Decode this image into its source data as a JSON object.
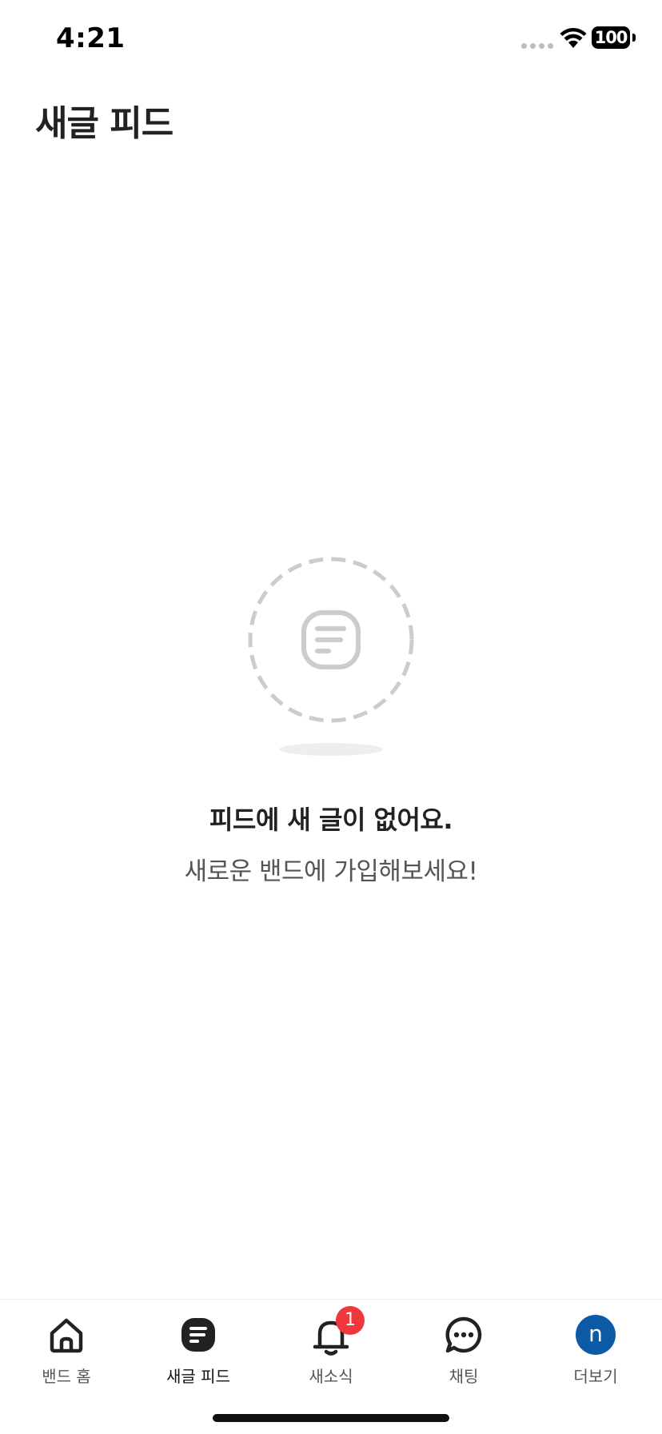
{
  "status_bar": {
    "time": "4:21",
    "battery": "100"
  },
  "header": {
    "title": "새글 피드"
  },
  "empty_state": {
    "icon": "feed-document-icon",
    "title": "피드에 새 글이 없어요.",
    "subtitle": "새로운 밴드에 가입해보세요!"
  },
  "tab_bar": {
    "tabs": [
      {
        "label": "밴드 홈",
        "icon": "home-icon",
        "active": false
      },
      {
        "label": "새글 피드",
        "icon": "feed-icon",
        "active": true
      },
      {
        "label": "새소식",
        "icon": "bell-icon",
        "active": false,
        "badge": "1"
      },
      {
        "label": "채팅",
        "icon": "chat-bubble-icon",
        "active": false
      },
      {
        "label": "더보기",
        "icon": "profile-avatar",
        "active": false,
        "avatar_letter": "n"
      }
    ]
  },
  "colors": {
    "badge": "#f0373c",
    "avatar": "#0d5aa7",
    "illustration": "#cccccc",
    "active_tab": "#222222"
  }
}
